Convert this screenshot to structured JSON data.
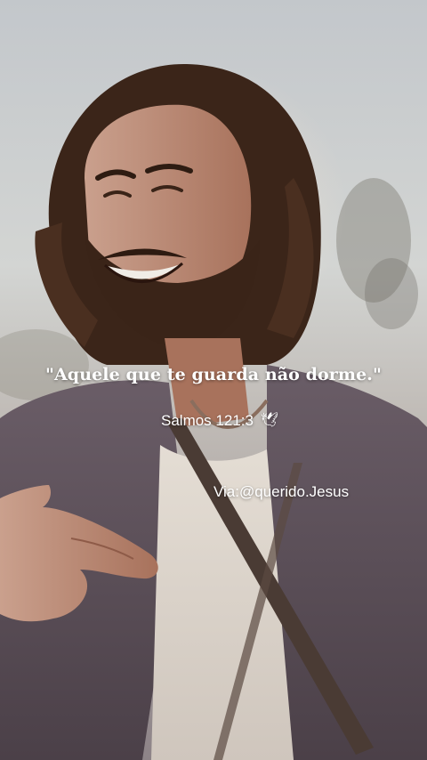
{
  "overlay": {
    "quote": "\"Aquele que te guarda não dorme.\"",
    "reference": "Salmos 121:3",
    "reference_icon": "dove-icon",
    "via": "Via:@querido.Jesus"
  },
  "colors": {
    "text": "#ffffff",
    "robe": "#5b4e57",
    "tunic": "#d8d1c9",
    "hair": "#3a2418",
    "skin": "#b9806a",
    "sky": "#cfd3d6"
  }
}
